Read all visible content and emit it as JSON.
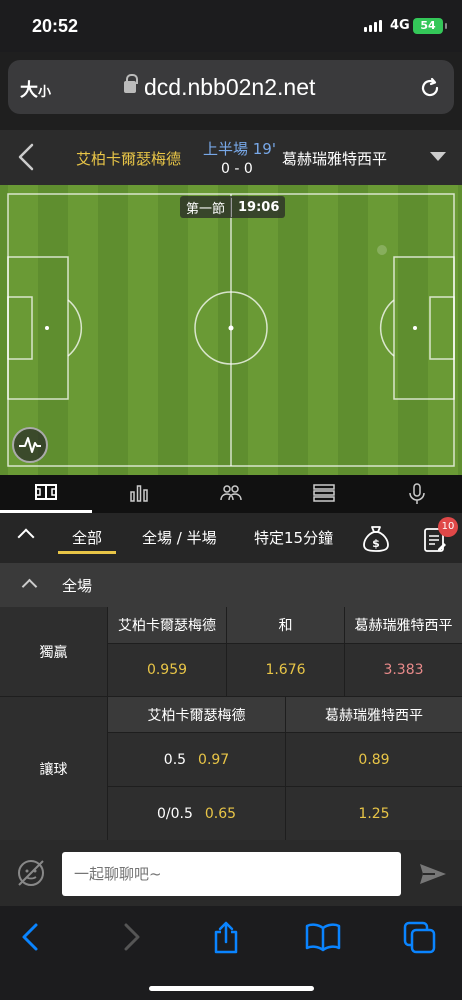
{
  "status_bar": {
    "time": "20:52",
    "network": "4G",
    "battery": "54"
  },
  "browser": {
    "text_size_label": "大",
    "text_size_small": "小",
    "url": "dcd.nbb02n2.net"
  },
  "match": {
    "home_team": "艾柏卡爾瑟梅德",
    "away_team": "葛赫瑞雅特西平",
    "period": "上半場 19'",
    "score": "0 - 0"
  },
  "pitch": {
    "clock_label": "第一節",
    "clock_time": "19:06"
  },
  "icon_tabs": [
    "field-icon",
    "stats-icon",
    "lineup-icon",
    "list-icon",
    "mic-icon"
  ],
  "filters": {
    "items": [
      "全部",
      "全場 / 半場",
      "特定15分鐘"
    ],
    "active": "全部",
    "notification_count": "10"
  },
  "section": {
    "title": "全場"
  },
  "market_1x2": {
    "label": "獨贏",
    "headers": [
      "艾柏卡爾瑟梅德",
      "和",
      "葛赫瑞雅特西平"
    ],
    "odds": [
      "0.959",
      "1.676",
      "3.383"
    ]
  },
  "market_handicap": {
    "label": "讓球",
    "headers": [
      "艾柏卡爾瑟梅德",
      "葛赫瑞雅特西平"
    ],
    "rows": [
      {
        "line": "0.5",
        "home": "0.97",
        "away": "0.89"
      },
      {
        "line": "0/0.5",
        "home": "0.65",
        "away": "1.25"
      }
    ]
  },
  "chat": {
    "placeholder": "一起聊聊吧~"
  },
  "colors": {
    "accent": "#e8c547",
    "period": "#78a8e8",
    "pitch": "#6a9a35",
    "badge": "#e04848"
  }
}
